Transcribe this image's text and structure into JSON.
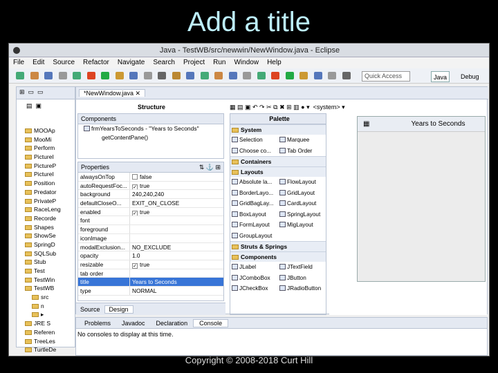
{
  "slide": {
    "title": "Add a title",
    "footer": "Copyright © 2008-2018 Curt Hill"
  },
  "window": {
    "title": "Java - TestWB/src/newwin/NewWindow.java - Eclipse"
  },
  "menu": [
    "File",
    "Edit",
    "Source",
    "Refactor",
    "Navigate",
    "Search",
    "Project",
    "Run",
    "Window",
    "Help"
  ],
  "toolbar": {
    "quick_access": "Quick Access",
    "perspectives": [
      "Java",
      "Debug"
    ]
  },
  "package_explorer": {
    "items": [
      "MOOAp",
      "MooMi",
      "Perform",
      "PictureI",
      "PictureP",
      "PictureI",
      "Position",
      "Predator",
      "PrivateP",
      "RaceLeng",
      "Recorde",
      "Shapes",
      "ShowSe",
      "SpringD",
      "SQLSub",
      "Stub",
      "Test",
      "TestWin",
      "TestWB",
      "src",
      "n",
      "▸",
      "JRE S",
      "Referen",
      "TreeLes",
      "TurtleDe"
    ]
  },
  "editor": {
    "tab": "*NewWindow.java",
    "structure_label": "Structure",
    "palette_label": "Palette",
    "bottom_tabs": [
      "Source",
      "Design"
    ],
    "components_label": "Components",
    "components": [
      "frmYearsToSeconds - \"Years to Seconds\"",
      "getContentPane()"
    ],
    "properties_label": "Properties",
    "properties": [
      {
        "k": "alwaysOnTop",
        "v": "false",
        "chk": ""
      },
      {
        "k": "autoRequestFoc...",
        "v": "true",
        "chk": "✓"
      },
      {
        "k": "background",
        "v": "240,240,240",
        "chk": ""
      },
      {
        "k": "defaultCloseO...",
        "v": "EXIT_ON_CLOSE",
        "chk": ""
      },
      {
        "k": "enabled",
        "v": "true",
        "chk": "✓"
      },
      {
        "k": "font",
        "v": "",
        "chk": ""
      },
      {
        "k": "foreground",
        "v": "",
        "chk": ""
      },
      {
        "k": "iconImage",
        "v": "",
        "chk": ""
      },
      {
        "k": "modalExclusion...",
        "v": "NO_EXCLUDE",
        "chk": ""
      },
      {
        "k": "opacity",
        "v": "1.0",
        "chk": ""
      },
      {
        "k": "resizable",
        "v": "true",
        "chk": "✓"
      },
      {
        "k": "tab order",
        "v": "",
        "chk": ""
      },
      {
        "k": "title",
        "v": "Years to Seconds",
        "chk": ""
      },
      {
        "k": "type",
        "v": "NORMAL",
        "chk": ""
      }
    ],
    "system_selector": "<system>",
    "palette": [
      {
        "cat": "System",
        "rows": [
          [
            "Selection",
            "Marquee"
          ],
          [
            "Choose co...",
            "Tab Order"
          ]
        ]
      },
      {
        "cat": "Containers",
        "rows": []
      },
      {
        "cat": "Layouts",
        "rows": [
          [
            "Absolute la...",
            "FlowLayout"
          ],
          [
            "BorderLayo...",
            "GridLayout"
          ],
          [
            "GridBagLay...",
            "CardLayout"
          ],
          [
            "BoxLayout",
            "SpringLayout"
          ],
          [
            "FormLayout",
            "MigLayout"
          ],
          [
            "GroupLayout",
            ""
          ]
        ]
      },
      {
        "cat": "Struts & Springs",
        "rows": []
      },
      {
        "cat": "Components",
        "rows": [
          [
            "JLabel",
            "JTextField"
          ],
          [
            "JComboBox",
            "JButton"
          ],
          [
            "JCheckBox",
            "JRadioButton"
          ]
        ]
      }
    ],
    "preview_title": "Years to Seconds"
  },
  "bottom": {
    "tabs": [
      "Problems",
      "Javadoc",
      "Declaration",
      "Console"
    ],
    "console_msg": "No consoles to display at this time."
  }
}
